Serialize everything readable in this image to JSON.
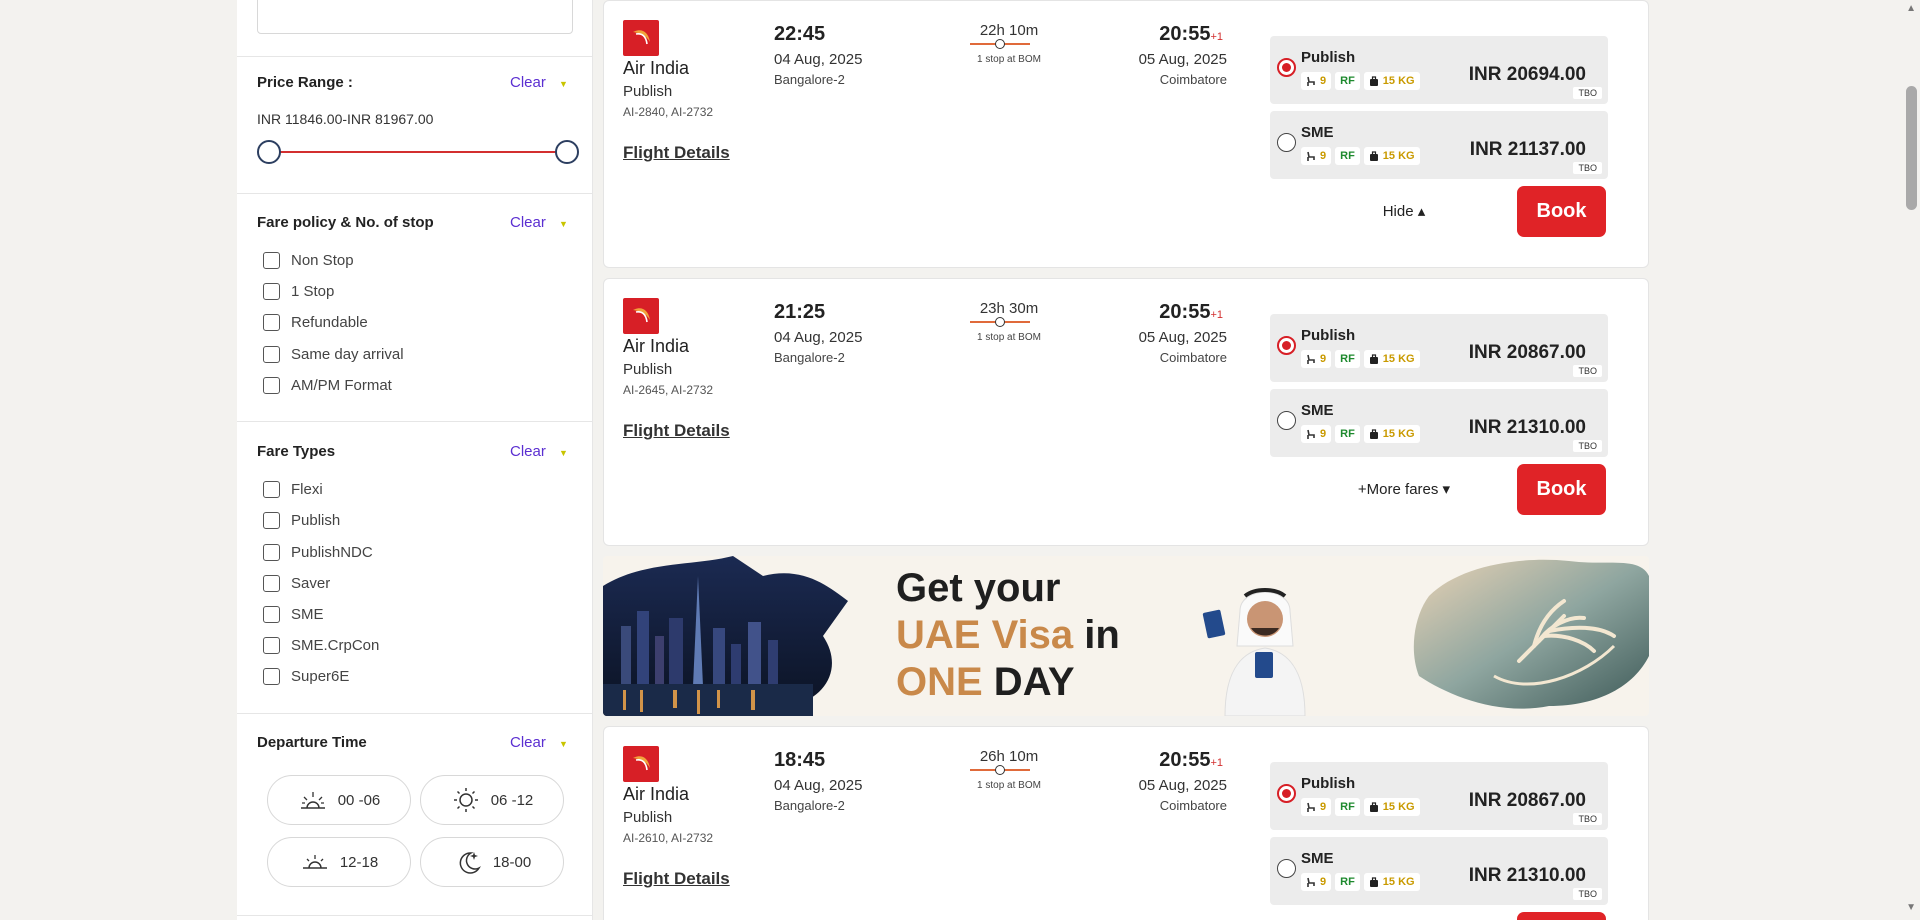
{
  "sidebar": {
    "price_range": {
      "title": "Price Range :",
      "clear": "Clear",
      "range_text": "INR 11846.00-INR 81967.00",
      "min_fraction": 0.0,
      "max_fraction": 1.0
    },
    "fare_policy": {
      "title": "Fare policy & No. of stop",
      "clear": "Clear",
      "options": [
        "Non Stop",
        "1 Stop",
        "Refundable",
        "Same day arrival",
        "AM/PM Format"
      ]
    },
    "fare_types": {
      "title": "Fare Types",
      "clear": "Clear",
      "options": [
        "Flexi",
        "Publish",
        "PublishNDC",
        "Saver",
        "SME",
        "SME.CrpCon",
        "Super6E"
      ]
    },
    "departure_time": {
      "title": "Departure Time",
      "clear": "Clear",
      "slots": [
        "00 -06",
        "06 -12",
        "12-18",
        "18-00"
      ]
    }
  },
  "flights": [
    {
      "airline": "Air India",
      "fare_type": "Publish",
      "flight_nos": "AI-2840, AI-2732",
      "details_label": "Flight Details",
      "dep_time": "22:45",
      "dep_date": "04 Aug, 2025",
      "dep_city": "Bangalore-2",
      "duration": "22h 10m",
      "stops": "1 stop at BOM",
      "arr_time": "20:55",
      "arr_plus": "+1",
      "arr_date": "05 Aug, 2025",
      "arr_city": "Coimbatore",
      "fares": [
        {
          "name": "Publish",
          "seats": "9",
          "rf": "RF",
          "baggage": "15 KG",
          "price": "INR 20694.00",
          "source": "TBO",
          "selected": true
        },
        {
          "name": "SME",
          "seats": "9",
          "rf": "RF",
          "baggage": "15 KG",
          "price": "INR 21137.00",
          "source": "TBO",
          "selected": false
        }
      ],
      "toggle": "Hide ▴",
      "book": "Book"
    },
    {
      "airline": "Air India",
      "fare_type": "Publish",
      "flight_nos": "AI-2645, AI-2732",
      "details_label": "Flight Details",
      "dep_time": "21:25",
      "dep_date": "04 Aug, 2025",
      "dep_city": "Bangalore-2",
      "duration": "23h 30m",
      "stops": "1 stop at BOM",
      "arr_time": "20:55",
      "arr_plus": "+1",
      "arr_date": "05 Aug, 2025",
      "arr_city": "Coimbatore",
      "fares": [
        {
          "name": "Publish",
          "seats": "9",
          "rf": "RF",
          "baggage": "15 KG",
          "price": "INR 20867.00",
          "source": "TBO",
          "selected": true
        },
        {
          "name": "SME",
          "seats": "9",
          "rf": "RF",
          "baggage": "15 KG",
          "price": "INR 21310.00",
          "source": "TBO",
          "selected": false
        }
      ],
      "toggle": "+More fares ▾",
      "book": "Book"
    },
    {
      "airline": "Air India",
      "fare_type": "Publish",
      "flight_nos": "AI-2610, AI-2732",
      "details_label": "Flight Details",
      "dep_time": "18:45",
      "dep_date": "04 Aug, 2025",
      "dep_city": "Bangalore-2",
      "duration": "26h 10m",
      "stops": "1 stop at BOM",
      "arr_time": "20:55",
      "arr_plus": "+1",
      "arr_date": "05 Aug, 2025",
      "arr_city": "Coimbatore",
      "fares": [
        {
          "name": "Publish",
          "seats": "9",
          "rf": "RF",
          "baggage": "15 KG",
          "price": "INR 20867.00",
          "source": "TBO",
          "selected": true
        },
        {
          "name": "SME",
          "seats": "9",
          "rf": "RF",
          "baggage": "15 KG",
          "price": "INR 21310.00",
          "source": "TBO",
          "selected": false
        }
      ]
    }
  ],
  "banner": {
    "line1": "Get your",
    "line2_hl": "UAE Visa",
    "line2_rest": " in",
    "line3_hl": "ONE",
    "line3_rest": " DAY"
  },
  "colors": {
    "brand_red": "#e02327",
    "clear_purple": "#5b2fd1",
    "tag_green": "#1e8a2e",
    "tag_gold": "#c99a00"
  }
}
